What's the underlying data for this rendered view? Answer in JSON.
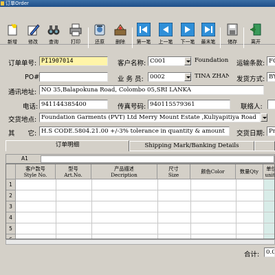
{
  "window": {
    "title": "订单Order"
  },
  "toolbar": {
    "buttons": [
      {
        "label": "新增",
        "icon": "new-file-icon"
      },
      {
        "label": "修改",
        "icon": "edit-icon"
      },
      {
        "label": "查询",
        "icon": "binoculars-icon"
      },
      {
        "label": "打印",
        "icon": "printer-icon"
      },
      {
        "label": "还原",
        "icon": "restore-icon"
      },
      {
        "label": "删除",
        "icon": "delete-icon"
      },
      {
        "label": "第一笔",
        "icon": "first-record-icon"
      },
      {
        "label": "上一笔",
        "icon": "previous-record-icon"
      },
      {
        "label": "下一笔",
        "icon": "next-record-icon"
      },
      {
        "label": "最末笔",
        "icon": "last-record-icon"
      },
      {
        "label": "储存",
        "icon": "save-icon"
      },
      {
        "label": "离开",
        "icon": "exit-icon"
      }
    ]
  },
  "form": {
    "order_no": {
      "label": "订单单号:",
      "value": "PI1907014"
    },
    "customer": {
      "label": "客户名称:",
      "code": "C001",
      "name": "Foundation"
    },
    "shipping_terms": {
      "label": "运输条款:",
      "value": "FO"
    },
    "po": {
      "label": "PO#:",
      "value": ""
    },
    "salesman": {
      "label": "业 务 员:",
      "code": "0002",
      "name": "TINA ZHANG"
    },
    "ship_method": {
      "label": "发货方式:",
      "value": "BY"
    },
    "address": {
      "label": "通讯地址:",
      "value": "NO 35,Balapokuna Road, Colombo 05,SRI LANKA"
    },
    "phone": {
      "label": "电话:",
      "value": "941144385400"
    },
    "fax": {
      "label": "传真号码:",
      "value": "940115579361"
    },
    "contact": {
      "label": "联络人:",
      "value": ""
    },
    "delivery_place": {
      "label": "交货地点:",
      "value": "Foundation Garments (PVT) Ltd Merry Mount Estate ,Kuliyapitiya Road"
    },
    "other": {
      "label": "其　　它:",
      "value": "H.S CODE.5804.21.00  +/-3% tolerance in quantity & amount"
    },
    "delivery_date": {
      "label": "交货日期:",
      "value": "Pr"
    }
  },
  "tabs": [
    {
      "label": "订单明细",
      "active": true
    },
    {
      "label": "Shipping Mark/Banking Details",
      "active": false
    }
  ],
  "grid": {
    "cell_ref": "A1",
    "columns": [
      {
        "cn": "客户款号",
        "en": "Style No."
      },
      {
        "cn": "型号",
        "en": "Art.No."
      },
      {
        "cn": "产品描述",
        "en": "Decription"
      },
      {
        "cn": "尺寸",
        "en": "Size"
      },
      {
        "cn": "颜色Color",
        "en": ""
      },
      {
        "cn": "数量Qty",
        "en": ""
      },
      {
        "cn": "单位",
        "en": "units"
      }
    ],
    "row_numbers": [
      "1",
      "2",
      "3",
      "4",
      "5",
      "6"
    ]
  },
  "footer": {
    "total_label": "合计:",
    "total_value": "0.0"
  }
}
